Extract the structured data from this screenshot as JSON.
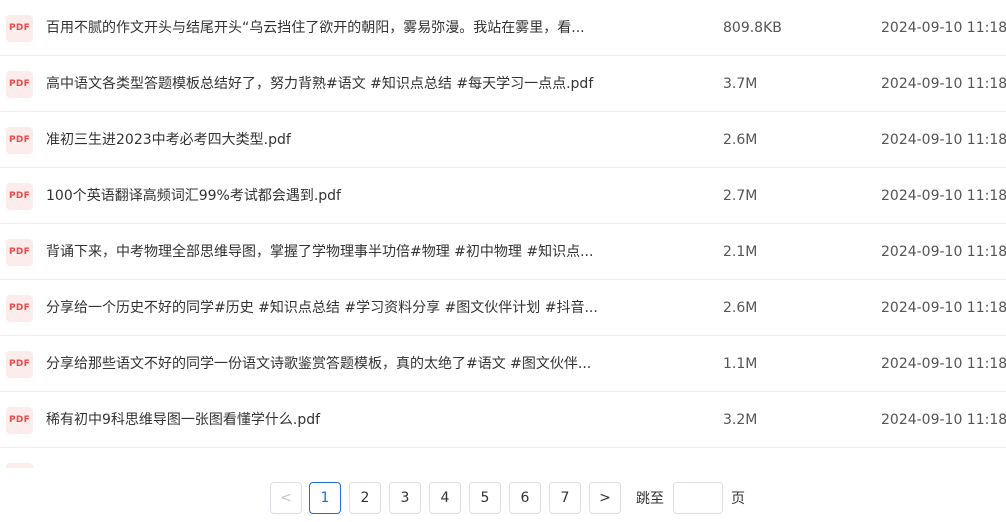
{
  "icon_label": "PDF",
  "colors": {
    "pdf_icon_bg": "#fdecec",
    "pdf_icon_text": "#e84c4c",
    "active_page": "#1e6fd9"
  },
  "files": [
    {
      "name": "百用不腻的作文开头与结尾开头“乌云挡住了欲开的朝阳，雾易弥漫。我站在雾里，看...",
      "size": "809.8KB",
      "date": "2024-09-10 11:18"
    },
    {
      "name": "高中语文各类型答题模板总结好了，努力背熟#语文 #知识点总结 #每天学习一点点.pdf",
      "size": "3.7M",
      "date": "2024-09-10 11:18"
    },
    {
      "name": "准初三生进2023中考必考四大类型.pdf",
      "size": "2.6M",
      "date": "2024-09-10 11:18"
    },
    {
      "name": "100个英语翻译高频词汇99%考试都会遇到.pdf",
      "size": "2.7M",
      "date": "2024-09-10 11:18"
    },
    {
      "name": "背诵下来，中考物理全部思维导图，掌握了学物理事半功倍#物理 #初中物理 #知识点...",
      "size": "2.1M",
      "date": "2024-09-10 11:18"
    },
    {
      "name": "分享给一个历史不好的同学#历史 #知识点总结 #学习资料分享 #图文伙伴计划 #抖音...",
      "size": "2.6M",
      "date": "2024-09-10 11:18"
    },
    {
      "name": "分享给那些语文不好的同学一份语文诗歌鉴赏答题模板，真的太绝了#语文 #图文伙伴...",
      "size": "1.1M",
      "date": "2024-09-10 11:18"
    },
    {
      "name": "稀有初中9科思维导图一张图看懂学什么.pdf",
      "size": "3.2M",
      "date": "2024-09-10 11:18"
    }
  ],
  "pagination": {
    "prev_label": "<",
    "next_label": ">",
    "pages": [
      "1",
      "2",
      "3",
      "4",
      "5",
      "6",
      "7"
    ],
    "current_page": 1,
    "jump_prefix": "跳至",
    "jump_suffix": "页",
    "jump_value": ""
  }
}
